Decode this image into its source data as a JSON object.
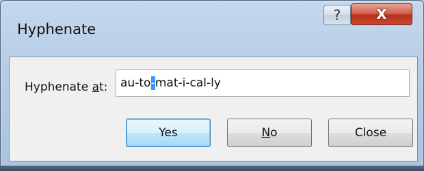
{
  "window": {
    "title": "Hyphenate",
    "help_glyph": "?",
    "close_glyph": "X"
  },
  "form": {
    "label_prefix": "Hyphenate ",
    "label_accel": "a",
    "label_suffix": "t:",
    "word_before": "au-to",
    "word_highlight": "-",
    "word_after": "mat-i-cal-ly"
  },
  "buttons": {
    "yes": "Yes",
    "no_accel": "N",
    "no_rest": "o",
    "close": "Close"
  },
  "colors": {
    "close_button": "#c94a34",
    "selection": "#3399ff",
    "default_button_border": "#3c7fb1"
  }
}
